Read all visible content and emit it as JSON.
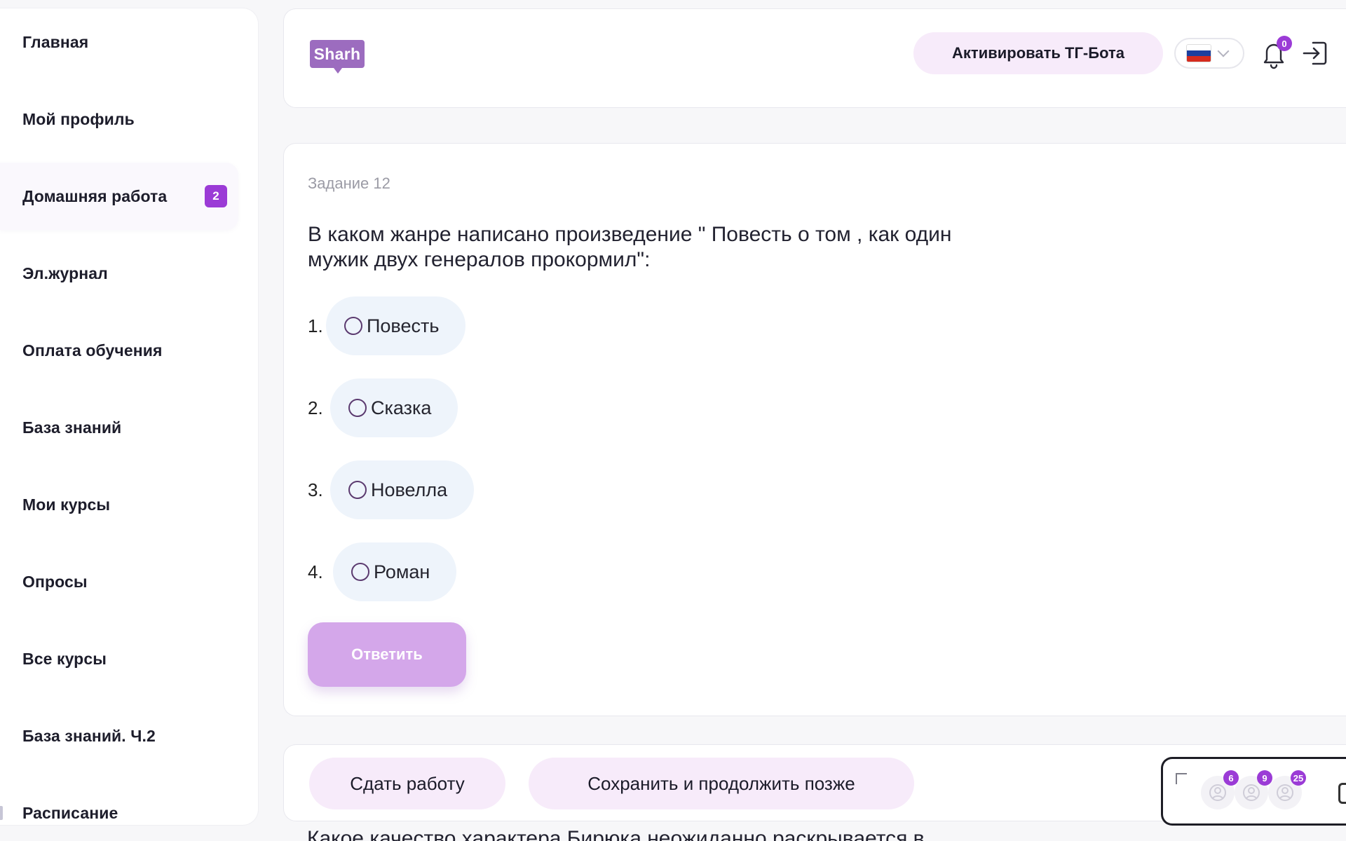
{
  "sidebar": {
    "items": [
      {
        "label": "Главная"
      },
      {
        "label": "Мой профиль"
      },
      {
        "label": "Домашняя работа",
        "badge": "2",
        "active": true
      },
      {
        "label": "Эл.журнал"
      },
      {
        "label": "Оплата обучения"
      },
      {
        "label": "База знаний"
      },
      {
        "label": "Мои курсы"
      },
      {
        "label": "Опросы"
      },
      {
        "label": "Все курсы"
      },
      {
        "label": "База знаний. Ч.2"
      },
      {
        "label": "Расписание"
      }
    ]
  },
  "header": {
    "logo_text": "Sharh",
    "tg_button": "Активировать ТГ-Бота",
    "notifications_count": "0",
    "language_flag": "ru-flag"
  },
  "task": {
    "number_label": "Задание 12",
    "question": "В каком жанре написано произведение \" Повесть о том , как один мужик двух генералов прокормил\":",
    "options": [
      {
        "num": "1.",
        "label": "Повесть"
      },
      {
        "num": "2.",
        "label": "Сказка"
      },
      {
        "num": "3.",
        "label": "Новелла"
      },
      {
        "num": "4.",
        "label": "Роман"
      }
    ],
    "answer_button": "Ответить"
  },
  "footer": {
    "submit_button": "Сдать работу",
    "save_button": "Сохранить и продолжить позже",
    "next_question_partial": "Какое качество характера Бирюка неожиданно раскрывается в"
  },
  "widget": {
    "counts": [
      "6",
      "9",
      "25"
    ]
  },
  "colors": {
    "accent": "#9b3bd6",
    "pill_bg": "#f7ebfa",
    "option_bg": "#eef4fb",
    "answer_btn": "#d4a7ea"
  }
}
